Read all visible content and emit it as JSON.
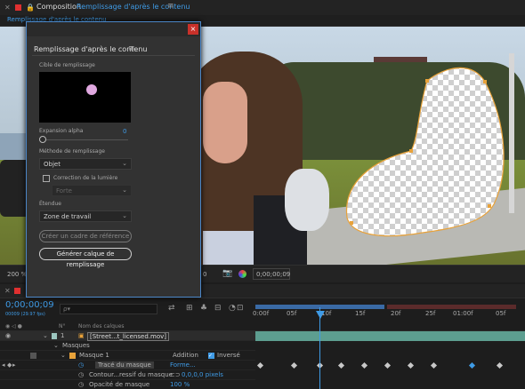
{
  "composition": {
    "panel_title": "Composition",
    "comp_name": "Remplissage d'après le contenu",
    "tab_label": "Remplissage d'après le contenu"
  },
  "viewer": {
    "zoom": "200 %",
    "zoom_partial": "0",
    "timecode": "0;00;00;09"
  },
  "dialog": {
    "close_glyph": "×",
    "panel_title": "Remplissage d'après le contenu",
    "menu_glyph": "≡",
    "target_label": "Cible de remplissage",
    "alpha_label": "Expansion alpha",
    "alpha_value": "0",
    "method_label": "Méthode de remplissage",
    "method_value": "Objet",
    "light_correction_label": "Correction de la lumière",
    "light_strength_value": "Forte",
    "range_label": "Étendue",
    "range_value": "Zone de travail",
    "ref_frame_button": "Créer un cadre de référence",
    "generate_button": "Générer calque de remplissage"
  },
  "timeline": {
    "timecode": "0;00;00;09",
    "fps_text": "00009 (29.97 fps)",
    "search_placeholder": "ρ▾",
    "ruler_ticks": [
      "0:00f",
      "05f",
      "10f",
      "15f",
      "20f",
      "25f",
      "01:00f",
      "05f"
    ],
    "col_layer_num": "N°",
    "col_layer_name": "Nom des calques",
    "layer_number": "1",
    "layer_name": "[Street...t_licensed.mov]",
    "masks_group": "Masques",
    "mask_name": "Masque 1",
    "mask_mode": "Addition",
    "inverted_label": "Inversé",
    "prop_path": "Tracé du masque",
    "prop_path_value": "Forme...",
    "prop_feather": "Contour...ressif du masque",
    "prop_feather_value": "0,0,0,0 pixels",
    "prop_opacity": "Opacité de masque",
    "prop_opacity_value": "100 %"
  },
  "colors": {
    "accent": "#3f9be6",
    "close_red": "#c8312a",
    "mask_path": "#e8a23a"
  }
}
